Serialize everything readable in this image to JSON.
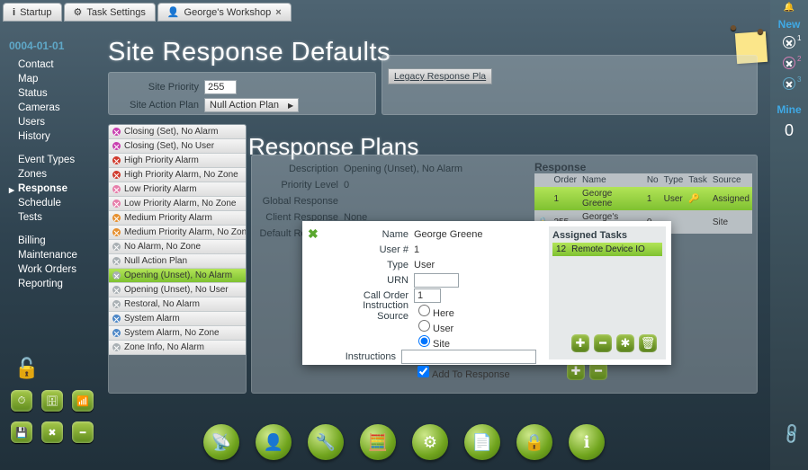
{
  "tabs": [
    {
      "label": "Startup"
    },
    {
      "label": "Task Settings"
    },
    {
      "label": "George's Workshop"
    }
  ],
  "rightbar": {
    "new": "New",
    "mine": "Mine",
    "count": "0",
    "s1": "1",
    "s2": "2",
    "s3": "3"
  },
  "date": "0004-01-01",
  "nav1": [
    "Contact",
    "Map",
    "Status",
    "Cameras",
    "Users",
    "History"
  ],
  "nav2": [
    "Event Types",
    "Zones",
    "Response",
    "Schedule",
    "Tests"
  ],
  "nav2_active": 2,
  "nav3": [
    "Billing",
    "Maintenance",
    "Work Orders",
    "Reporting"
  ],
  "titles": {
    "defaults": "Site Response Defaults",
    "plans": "Response Plans"
  },
  "defaults": {
    "priority_label": "Site Priority",
    "priority_value": "255",
    "plan_label": "Site Action Plan",
    "plan_value": "Null Action Plan"
  },
  "legacy_btn": "Legacy Response Pla",
  "plan_list": [
    {
      "c": "mag",
      "t": "Closing (Set), No Alarm"
    },
    {
      "c": "mag",
      "t": "Closing (Set), No User"
    },
    {
      "c": "red",
      "t": "High Priority Alarm"
    },
    {
      "c": "red",
      "t": "High Priority Alarm, No Zone"
    },
    {
      "c": "pink",
      "t": "Low Priority Alarm"
    },
    {
      "c": "pink",
      "t": "Low Priority Alarm, No Zone"
    },
    {
      "c": "org",
      "t": "Medium Priority Alarm"
    },
    {
      "c": "org",
      "t": "Medium Priority Alarm, No Zone"
    },
    {
      "c": "gry",
      "t": "No Alarm, No Zone"
    },
    {
      "c": "gry",
      "t": "Null Action Plan"
    },
    {
      "c": "gry",
      "t": "Opening (Unset), No Alarm",
      "sel": true
    },
    {
      "c": "gry",
      "t": "Opening (Unset), No User"
    },
    {
      "c": "gry",
      "t": "Restoral, No Alarm"
    },
    {
      "c": "blu",
      "t": "System Alarm"
    },
    {
      "c": "blu",
      "t": "System Alarm, No Zone"
    },
    {
      "c": "gry",
      "t": "Zone Info, No Alarm"
    }
  ],
  "detail": {
    "desc_l": "Description",
    "desc_v": "Opening (Unset), No Alarm",
    "prio_l": "Priority Level",
    "prio_v": "0",
    "glob_l": "Global Response",
    "client_l": "Client Response",
    "client_v": "None",
    "def_l": "Default Response"
  },
  "resp": {
    "title": "Response",
    "cols": {
      "order": "Order",
      "name": "Name",
      "no": "No",
      "type": "Type",
      "task": "Task",
      "source": "Source"
    },
    "rows": [
      {
        "order": "1",
        "name": "George Greene",
        "no": "1",
        "type": "User",
        "task": "🔑",
        "source": "Assigned",
        "on": true
      },
      {
        "order": "255",
        "name": "George's Workshop",
        "no": "0",
        "type": "",
        "task": "",
        "source": "Site",
        "lock": true
      }
    ]
  },
  "pop": {
    "name_l": "Name",
    "name_v": "George Greene",
    "user_l": "User #",
    "user_v": "1",
    "type_l": "Type",
    "type_v": "User",
    "urn_l": "URN",
    "urn_v": "",
    "call_l": "Call Order",
    "call_v": "1",
    "src_l": "Instruction Source",
    "src_opts": {
      "here": "Here",
      "user": "User",
      "site": "Site"
    },
    "src_sel": "site",
    "inst_l": "Instructions",
    "inst_v": "",
    "add_l": "Add To Response",
    "add_chk": true,
    "tasks_title": "Assigned Tasks",
    "task_no": "12",
    "task_name": "Remote Device IO"
  }
}
